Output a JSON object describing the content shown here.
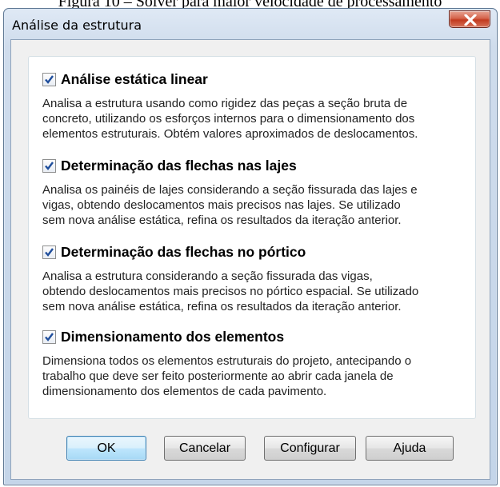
{
  "caption": "Figura 10 – Solver para maior velocidade de processamento",
  "window": {
    "title": "Análise da estrutura"
  },
  "options": [
    {
      "label": "Análise estática linear",
      "checked": true,
      "desc": [
        "Analisa a estrutura usando como rigidez das peças a seção bruta de",
        "concreto, utilizando os esforços internos para o dimensionamento dos",
        "elementos estruturais. Obtém valores aproximados de deslocamentos."
      ]
    },
    {
      "label": "Determinação das flechas nas lajes",
      "checked": true,
      "desc": [
        "Analisa os painéis de lajes considerando a seção fissurada das lajes e",
        "vigas, obtendo deslocamentos mais precisos nas lajes. Se utilizado",
        "sem nova análise estática, refina os resultados da iteração anterior."
      ]
    },
    {
      "label": "Determinação das flechas no pórtico",
      "checked": true,
      "desc": [
        "Analisa a estrutura considerando a seção fissurada das vigas,",
        "obtendo deslocamentos mais precisos no pórtico espacial. Se utilizado",
        "sem nova análise estática, refina os resultados da iteração anterior."
      ]
    },
    {
      "label": "Dimensionamento dos elementos",
      "checked": true,
      "desc": [
        "Dimensiona todos os elementos estruturais do projeto, antecipando o",
        "trabalho que deve ser feito posteriormente ao abrir cada janela de",
        "dimensionamento dos elementos de cada pavimento."
      ]
    }
  ],
  "buttons": {
    "ok": "OK",
    "cancel": "Cancelar",
    "configure": "Configurar",
    "help": "Ajuda"
  },
  "icons": {
    "close": "close-icon",
    "check": "checkmark-icon"
  },
  "colors": {
    "title_bar": "#c4d5e9",
    "close_button": "#c23a1f",
    "check": "#1f4e9c",
    "default_button": "#a7d9f5"
  }
}
